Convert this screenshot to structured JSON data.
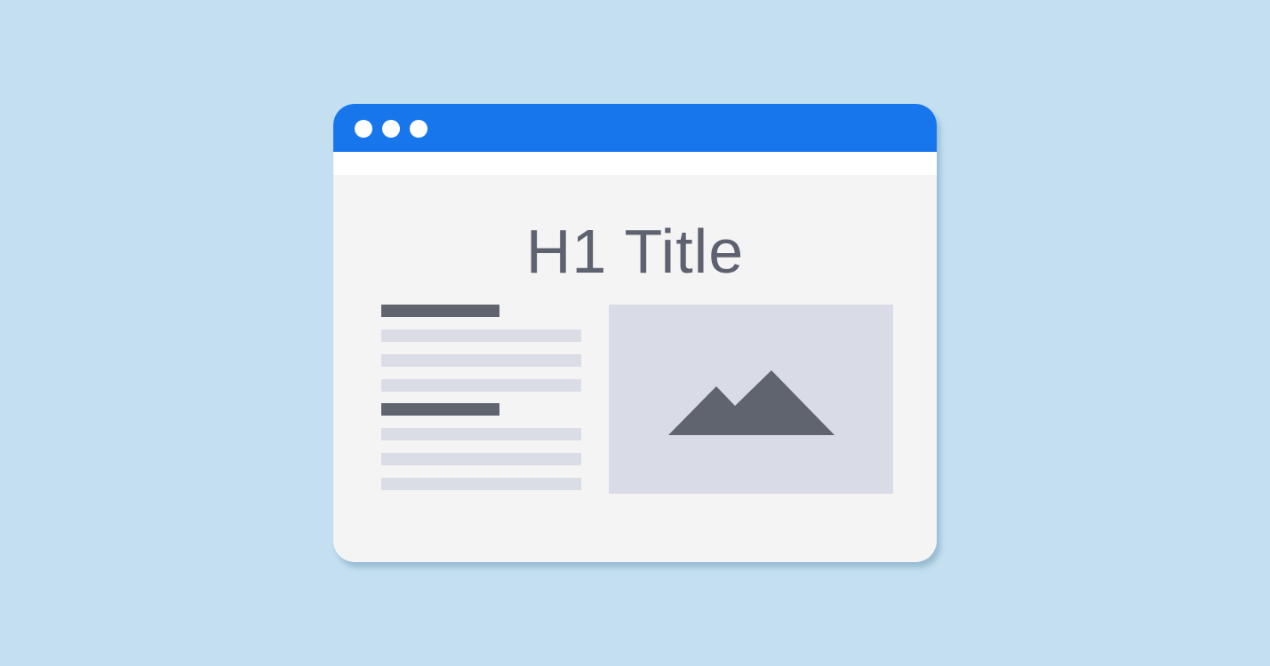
{
  "page": {
    "title": "H1 Title"
  },
  "colors": {
    "background": "#c3dff0",
    "titlebar": "#1876ec",
    "window": "#f4f4f4",
    "text": "#5e6270",
    "placeholder_dark": "#60646f",
    "placeholder_light": "#dadce6"
  },
  "icons": {
    "window_controls": [
      "window-dot-icon",
      "window-dot-icon",
      "window-dot-icon"
    ],
    "image": "mountain-image-icon"
  }
}
